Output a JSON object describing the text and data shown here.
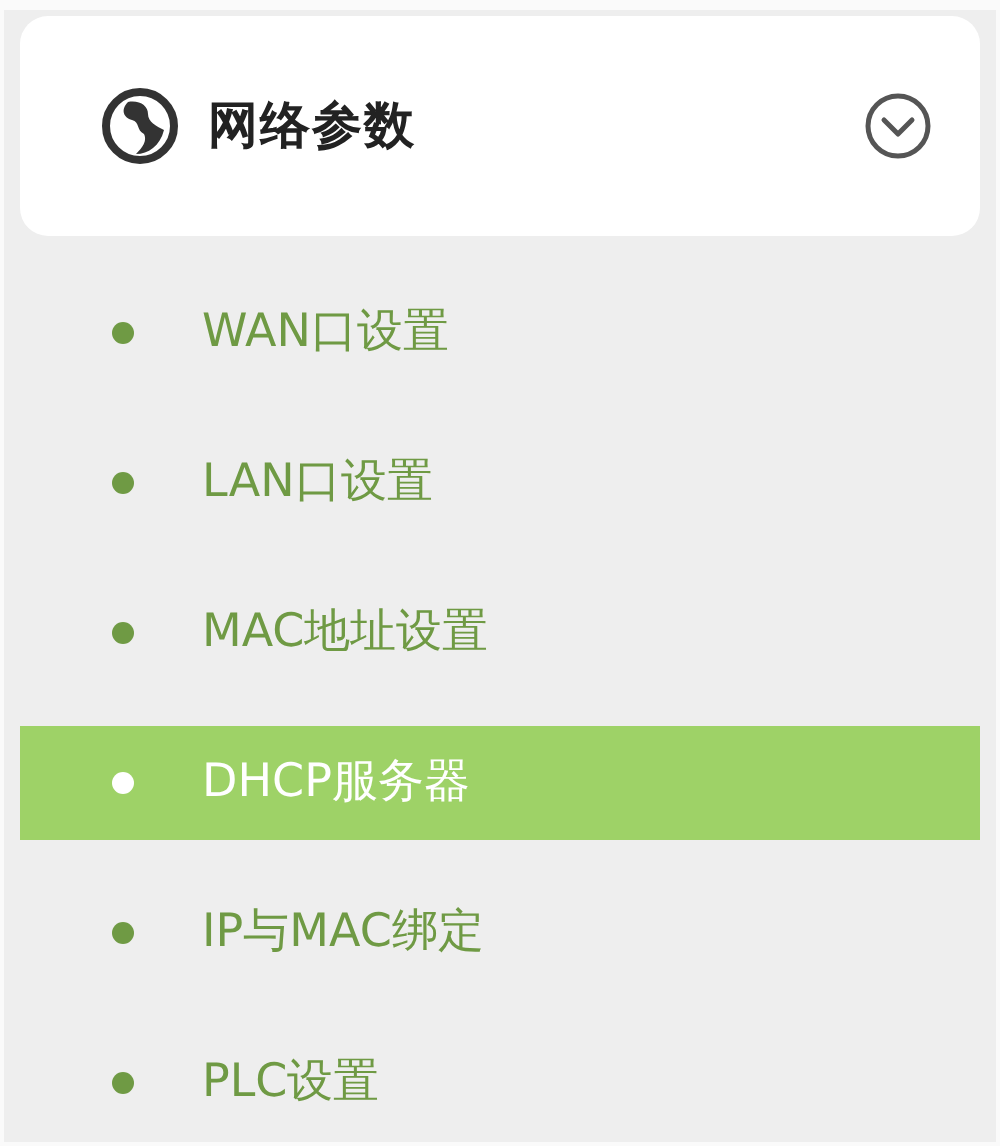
{
  "menu": {
    "title": "网络参数",
    "expanded": true,
    "items": [
      {
        "label": "WAN口设置",
        "selected": false
      },
      {
        "label": "LAN口设置",
        "selected": false
      },
      {
        "label": "MAC地址设置",
        "selected": false
      },
      {
        "label": "DHCP服务器",
        "selected": true
      },
      {
        "label": "IP与MAC绑定",
        "selected": false
      },
      {
        "label": "PLC设置",
        "selected": false
      }
    ]
  }
}
